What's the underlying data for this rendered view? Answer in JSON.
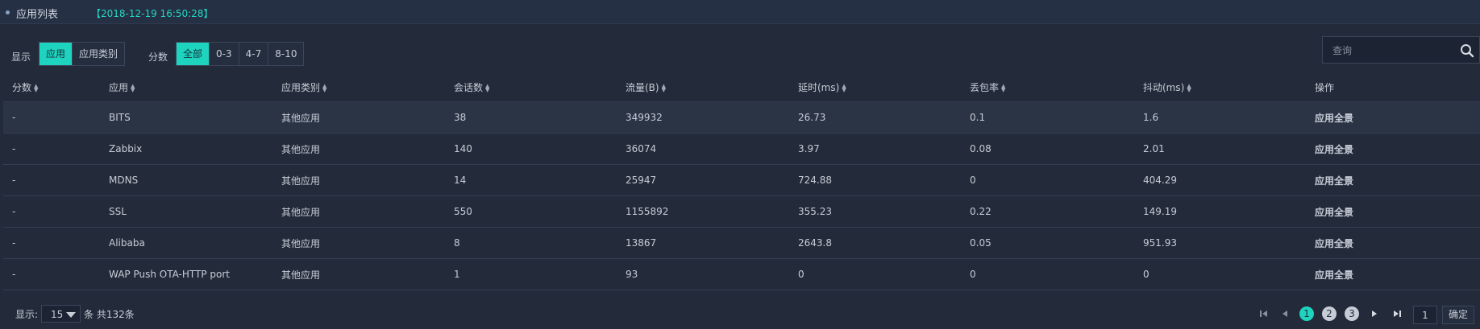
{
  "header": {
    "title": "应用列表",
    "timestamp": "【2018-12-19 16:50:28】"
  },
  "filters": {
    "display_label": "显示",
    "display_options": [
      "应用",
      "应用类别"
    ],
    "display_selected": "应用",
    "score_label": "分数",
    "score_options": [
      "全部",
      "0-3",
      "4-7",
      "8-10"
    ],
    "score_selected": "全部"
  },
  "search": {
    "placeholder": "查询",
    "value": ""
  },
  "table": {
    "columns": [
      "分数",
      "应用",
      "应用类别",
      "会话数",
      "流量(B)",
      "延时(ms)",
      "丢包率",
      "抖动(ms)",
      "操作"
    ],
    "rows": [
      {
        "score": "-",
        "app": "BITS",
        "category": "其他应用",
        "sessions": "38",
        "traffic": "349932",
        "latency": "26.73",
        "loss": "0.1",
        "jitter": "1.6",
        "action": "应用全景"
      },
      {
        "score": "-",
        "app": "Zabbix",
        "category": "其他应用",
        "sessions": "140",
        "traffic": "36074",
        "latency": "3.97",
        "loss": "0.08",
        "jitter": "2.01",
        "action": "应用全景"
      },
      {
        "score": "-",
        "app": "MDNS",
        "category": "其他应用",
        "sessions": "14",
        "traffic": "25947",
        "latency": "724.88",
        "loss": "0",
        "jitter": "404.29",
        "action": "应用全景"
      },
      {
        "score": "-",
        "app": "SSL",
        "category": "其他应用",
        "sessions": "550",
        "traffic": "1155892",
        "latency": "355.23",
        "loss": "0.22",
        "jitter": "149.19",
        "action": "应用全景"
      },
      {
        "score": "-",
        "app": "Alibaba",
        "category": "其他应用",
        "sessions": "8",
        "traffic": "13867",
        "latency": "2643.8",
        "loss": "0.05",
        "jitter": "951.93",
        "action": "应用全景"
      },
      {
        "score": "-",
        "app": "WAP Push OTA-HTTP port",
        "category": "其他应用",
        "sessions": "1",
        "traffic": "93",
        "latency": "0",
        "loss": "0",
        "jitter": "0",
        "action": "应用全景"
      }
    ]
  },
  "footer": {
    "display_label": "显示:",
    "page_size": "15",
    "total_text": "条 共132条",
    "pages": [
      "1",
      "2",
      "3"
    ],
    "current_page": "1",
    "goto_value": "1",
    "confirm_label": "确定"
  },
  "colors": {
    "accent": "#1fd4bf",
    "background": "#232b3a",
    "header": "#253044"
  }
}
